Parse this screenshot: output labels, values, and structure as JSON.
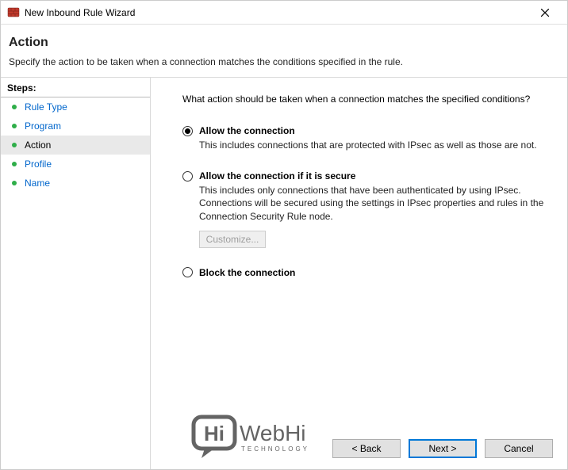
{
  "window": {
    "title": "New Inbound Rule Wizard"
  },
  "header": {
    "heading": "Action",
    "subheading": "Specify the action to be taken when a connection matches the conditions specified in the rule."
  },
  "sidebar": {
    "title": "Steps:",
    "items": [
      {
        "label": "Rule Type",
        "active": false
      },
      {
        "label": "Program",
        "active": false
      },
      {
        "label": "Action",
        "active": true
      },
      {
        "label": "Profile",
        "active": false
      },
      {
        "label": "Name",
        "active": false
      }
    ]
  },
  "main": {
    "prompt": "What action should be taken when a connection matches the specified conditions?",
    "options": [
      {
        "id": "allow",
        "title": "Allow the connection",
        "desc": "This includes connections that are protected with IPsec as well as those are not.",
        "selected": true
      },
      {
        "id": "allow_secure",
        "title": "Allow the connection if it is secure",
        "desc": "This includes only connections that have been authenticated by using IPsec.  Connections will be secured using the settings in IPsec properties and rules in the Connection Security Rule node.",
        "selected": false,
        "customize_label": "Customize..."
      },
      {
        "id": "block",
        "title": "Block the connection",
        "desc": "",
        "selected": false
      }
    ]
  },
  "buttons": {
    "back": "< Back",
    "next": "Next >",
    "cancel": "Cancel"
  },
  "watermark": {
    "text_main": "WebHi",
    "text_sub": "TECHNOLOGY",
    "bubble": "Hi"
  }
}
